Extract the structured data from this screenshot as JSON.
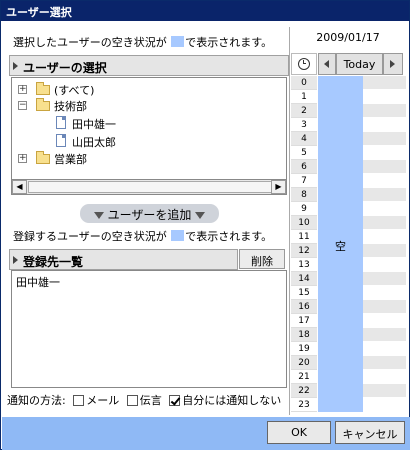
{
  "window": {
    "title": "ユーザー選択"
  },
  "left": {
    "hint_prefix": "選択したユーザーの空き状況が",
    "hint_suffix": "で表示されます。",
    "user_select_header": "ユーザーの選択",
    "tree": [
      {
        "label": "(すべて)",
        "expander": "+"
      },
      {
        "label": "技術部",
        "expander": "−"
      },
      {
        "label": "田中雄一"
      },
      {
        "label": "山田太郎"
      },
      {
        "label": "営業部",
        "expander": "+"
      }
    ],
    "add_button": "ユーザーを追加",
    "reg_hint_prefix": "登録するユーザーの空き状況が",
    "reg_hint_suffix": "で表示されます。",
    "registered_header": "登録先一覧",
    "delete_button": "削除",
    "registered": [
      "田中雄一"
    ],
    "notify": {
      "label": "通知の方法:",
      "mail": "メール",
      "mail_checked": false,
      "message": "伝言",
      "message_checked": false,
      "self": "自分には通知しない",
      "self_checked": true
    }
  },
  "right": {
    "date": "2009/01/17",
    "today_button": "Today",
    "hours": [
      "0",
      "1",
      "2",
      "3",
      "4",
      "5",
      "6",
      "7",
      "8",
      "9",
      "10",
      "11",
      "12",
      "13",
      "14",
      "15",
      "16",
      "17",
      "18",
      "19",
      "20",
      "21",
      "22",
      "23"
    ],
    "availability_label": "空",
    "availability_color": "#a7c9ff"
  },
  "footer": {
    "ok": "OK",
    "cancel": "キャンセル"
  }
}
